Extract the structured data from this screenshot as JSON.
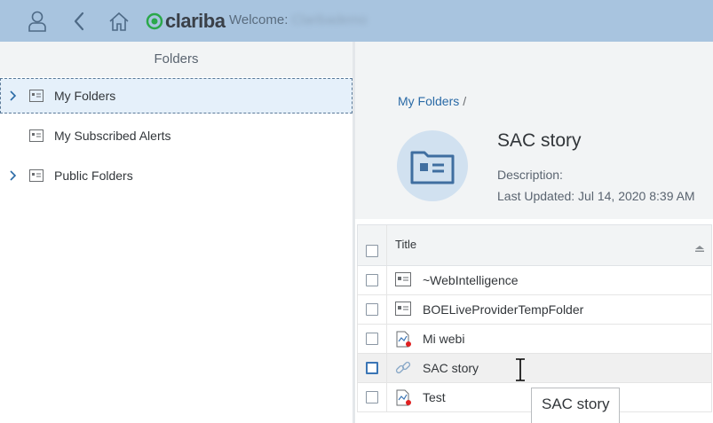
{
  "shell": {
    "logo_text": "clariba",
    "welcome_label": "Welcome:",
    "welcome_user": "Claribademo",
    "icons": [
      "user-icon",
      "back-icon",
      "home-icon"
    ]
  },
  "folders_panel": {
    "title": "Folders",
    "items": [
      {
        "label": "My Folders",
        "expandable": true,
        "selected": true
      },
      {
        "label": "My Subscribed Alerts",
        "expandable": false,
        "selected": false
      },
      {
        "label": "Public Folders",
        "expandable": true,
        "selected": false
      }
    ]
  },
  "detail": {
    "breadcrumb": "My Folders",
    "breadcrumb_sep": "/",
    "title": "SAC story",
    "description": "Description:",
    "last_updated": "Last Updated: Jul 14, 2020 8:39 AM"
  },
  "table": {
    "header_title": "Title",
    "rows": [
      {
        "label": "~WebIntelligence",
        "icon": "folder-icon"
      },
      {
        "label": "BOELiveProviderTempFolder",
        "icon": "folder-icon"
      },
      {
        "label": "Mi webi",
        "icon": "webi-document-icon"
      },
      {
        "label": "SAC story",
        "icon": "link-icon",
        "hovered": true
      },
      {
        "label": "Test",
        "icon": "webi-document-icon"
      }
    ]
  },
  "tooltip": "SAC story",
  "colors": {
    "shell_bar": "#a8c4df",
    "link": "#2a6aa6",
    "selection": "#e5f0fa",
    "logo_green": "#2aa84a"
  }
}
